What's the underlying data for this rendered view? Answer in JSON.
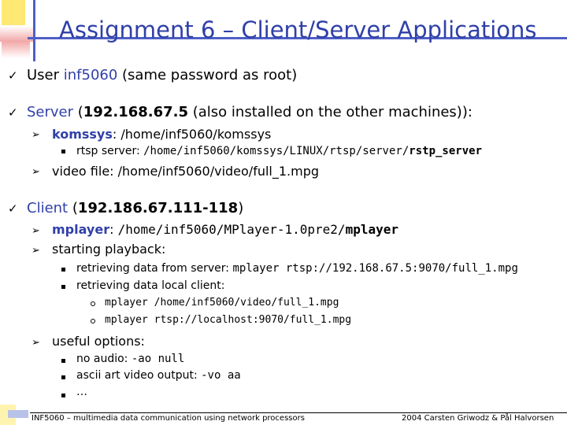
{
  "title": "Assignment 6 – Client/Server Applications",
  "user": {
    "prefix": "User ",
    "name": "inf5060",
    "suffix": " (same password as root)"
  },
  "server": {
    "prefix": "Server ",
    "open": "(",
    "ip": "192.168.67.5",
    "suffix": " (also installed on the other machines)):",
    "komssys": {
      "name": "komssys",
      "suffix": ": /home/inf5060/komssys"
    },
    "rtsp": {
      "label": "rtsp server: ",
      "path": "/home/inf5060/komssys/LINUX/rtsp/server/",
      "bin": "rstp_server"
    },
    "video": {
      "label": "video file: /home/inf5060/video/full_1.mpg"
    }
  },
  "client": {
    "prefix": "Client ",
    "open": "(",
    "ip": "192.186.67.111-118",
    "close": ")",
    "mplayer": {
      "name": "mplayer",
      "colon": ": ",
      "path": "/home/inf5060/MPlayer-1.0pre2/",
      "bin": "mplayer"
    },
    "playback": "starting playback:",
    "retrieve_server": {
      "label": "retrieving data from server: ",
      "cmd": "mplayer rtsp://192.168.67.5:9070/full_1.mpg"
    },
    "retrieve_local": {
      "label": "retrieving data local client:"
    },
    "local_cmd_1": "mplayer /home/inf5060/video/full_1.mpg",
    "local_cmd_2": "mplayer rtsp://localhost:9070/full_1.mpg",
    "useful": "useful options:",
    "no_audio": {
      "label": "no audio: ",
      "cmd": "-ao null"
    },
    "ascii": {
      "label": "ascii art video output: ",
      "cmd": "-vo aa"
    },
    "more": "…"
  },
  "footer": {
    "left": "INF5060 – multimedia data communication using network processors",
    "right": "2004  Carsten Griwodz & Pål Halvorsen"
  }
}
